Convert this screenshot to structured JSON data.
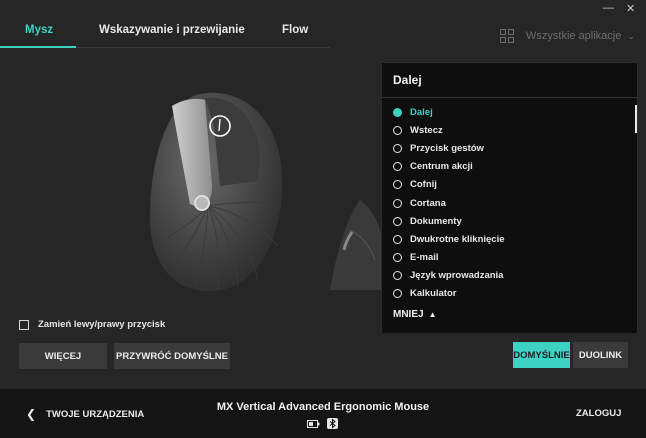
{
  "window": {
    "minimize": "—",
    "close": "✕"
  },
  "tabs": [
    {
      "label": "Mysz",
      "active": true
    },
    {
      "label": "Wskazywanie i przewijanie",
      "active": false
    },
    {
      "label": "Flow",
      "active": false
    }
  ],
  "apps": {
    "label": "Wszystkie aplikacje",
    "icon": "grid-icon"
  },
  "swap_buttons": {
    "label": "Zamień lewy/prawy przycisk",
    "checked": false
  },
  "buttons": {
    "more": "WIĘCEJ",
    "restore": "PRZYWRÓĆ DOMYŚLNE",
    "default": "DOMYŚLNIE",
    "duolink": "DUOLINK"
  },
  "panel": {
    "title": "Dalej",
    "options": [
      {
        "label": "Dalej",
        "selected": true
      },
      {
        "label": "Wstecz",
        "selected": false
      },
      {
        "label": "Przycisk gestów",
        "selected": false
      },
      {
        "label": "Centrum akcji",
        "selected": false
      },
      {
        "label": "Cofnij",
        "selected": false
      },
      {
        "label": "Cortana",
        "selected": false
      },
      {
        "label": "Dokumenty",
        "selected": false
      },
      {
        "label": "Dwukrotne kliknięcie",
        "selected": false
      },
      {
        "label": "E-mail",
        "selected": false
      },
      {
        "label": "Język wprowadzania",
        "selected": false
      },
      {
        "label": "Kalkulator",
        "selected": false
      }
    ],
    "less_label": "MNIEJ"
  },
  "footer": {
    "back_label": "TWOJE URZĄDZENIA",
    "device_name": "MX Vertical Advanced Ergonomic Mouse",
    "login_label": "ZALOGUJ"
  },
  "colors": {
    "accent": "#3ed2c3",
    "background": "#262626",
    "panel": "#0e0e0e",
    "footer": "#141414"
  }
}
